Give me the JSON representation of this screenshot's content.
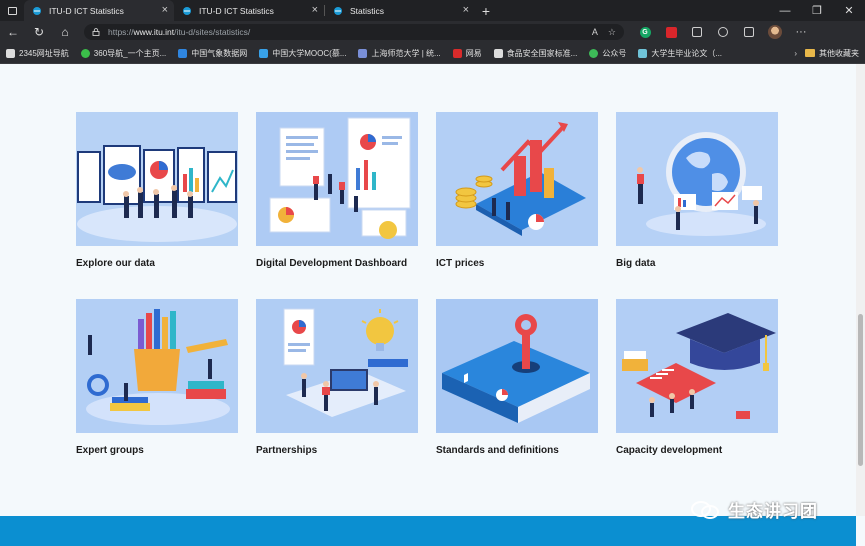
{
  "browser": {
    "tabs": [
      {
        "title": "ITU-D ICT Statistics",
        "active": true
      },
      {
        "title": "ITU-D ICT Statistics",
        "active": false
      },
      {
        "title": "Statistics",
        "active": false
      }
    ],
    "url_prefix": "https://",
    "url_host": "www.itu.int",
    "url_path": "/itu-d/sites/statistics/",
    "bookmarks": [
      "2345网址导航",
      "360导航_一个主页...",
      "中国气象数据网",
      "中国大学MOOC(慕...",
      "上海师范大学 | 统...",
      "网易",
      "食品安全国家标准...",
      "公众号",
      "大学生毕业论文（..."
    ],
    "bookmarks_folder": "其他收藏夹"
  },
  "cards": [
    {
      "label": "Explore our data",
      "icon": "data-wall-illustration"
    },
    {
      "label": "Digital Development Dashboard",
      "icon": "dashboard-illustration"
    },
    {
      "label": "ICT prices",
      "icon": "price-chart-illustration"
    },
    {
      "label": "Big data",
      "icon": "globe-data-illustration"
    },
    {
      "label": "Expert groups",
      "icon": "pencil-cup-illustration"
    },
    {
      "label": "Partnerships",
      "icon": "teamwork-illustration"
    },
    {
      "label": "Standards and definitions",
      "icon": "data-key-illustration"
    },
    {
      "label": "Capacity development",
      "icon": "graduation-cap-illustration"
    }
  ],
  "watermark": "生态讲习团",
  "colors": {
    "footer": "#0b8fd1",
    "thumb_bg": "#a9c9f2",
    "page_bg": "#f4f9fc"
  }
}
